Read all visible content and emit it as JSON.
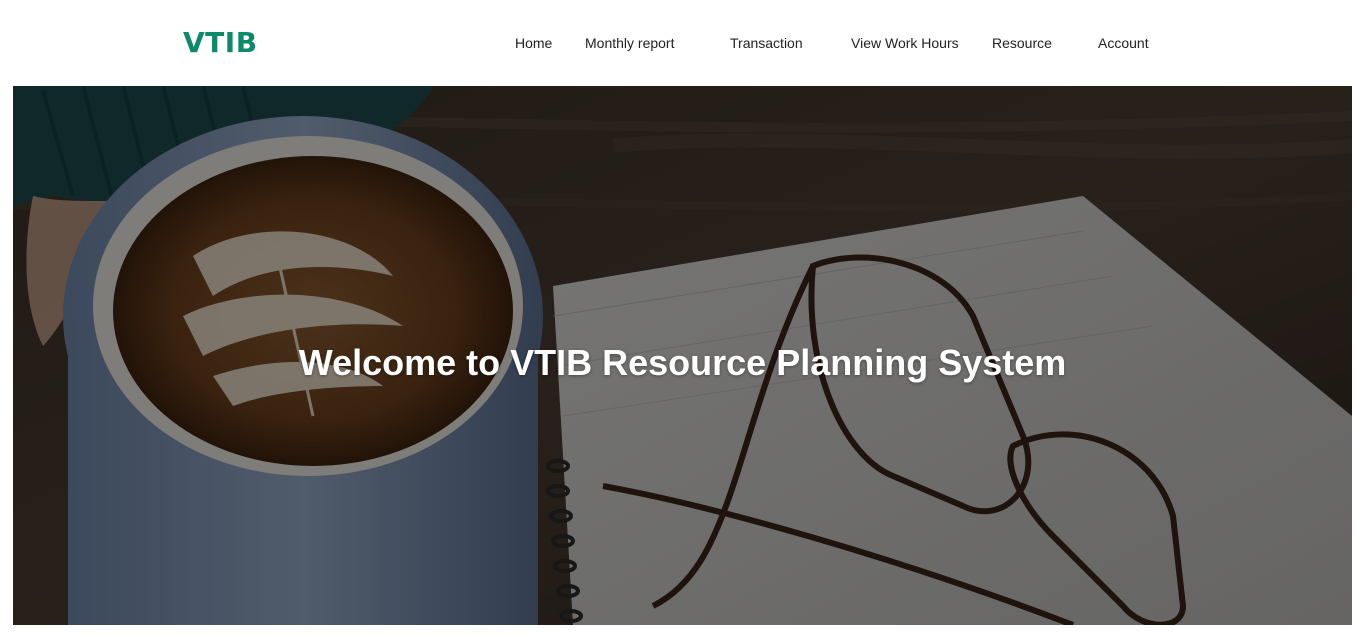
{
  "brand": {
    "logo_text": "VTIB",
    "accent_color": "#0e8a6a"
  },
  "nav": {
    "items": [
      {
        "label": "Home"
      },
      {
        "label": "Monthly report"
      },
      {
        "label": "Transaction"
      },
      {
        "label": "View Work Hours"
      },
      {
        "label": "Resource"
      },
      {
        "label": "Account"
      }
    ]
  },
  "hero": {
    "title": "Welcome to VTIB Resource Planning System",
    "background_image": "coffee cup with latte art, notebook and eyeglasses on wooden table (darkened overlay)"
  }
}
